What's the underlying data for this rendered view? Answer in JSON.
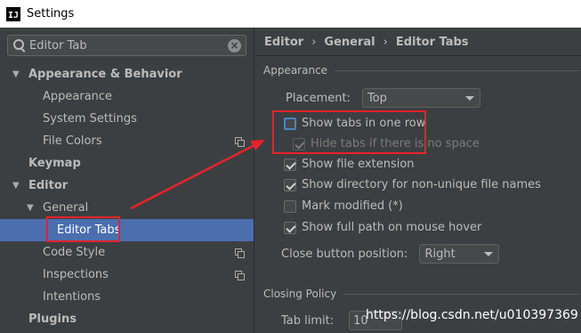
{
  "window": {
    "title": "Settings",
    "app_icon_text": "IJ"
  },
  "search": {
    "value": "Editor Tab",
    "clear_icon": "×"
  },
  "tree": {
    "items": [
      {
        "label": "Appearance & Behavior",
        "bold": true,
        "expanded": true
      },
      {
        "label": "Appearance"
      },
      {
        "label": "System Settings"
      },
      {
        "label": "File Colors"
      },
      {
        "label": "Keymap",
        "bold": true
      },
      {
        "label": "Editor",
        "bold": true,
        "expanded": true
      },
      {
        "label": "General",
        "expanded": true
      },
      {
        "label": "Editor Tabs",
        "selected": true
      },
      {
        "label": "Code Style"
      },
      {
        "label": "Inspections"
      },
      {
        "label": "Intentions"
      },
      {
        "label": "Plugins",
        "bold": true
      }
    ],
    "expanded_arrow": "▼"
  },
  "breadcrumb": {
    "items": [
      "Editor",
      "General",
      "Editor Tabs"
    ],
    "separator": "›"
  },
  "appearance": {
    "heading": "Appearance",
    "placement_label": "Placement:",
    "placement_value": "Top",
    "options": [
      {
        "label": "Show tabs in one row",
        "checked": false
      },
      {
        "label": "Hide tabs if there is no space",
        "checked": true,
        "disabled": true
      },
      {
        "label": "Show file extension",
        "checked": true
      },
      {
        "label": "Show directory for non-unique file names",
        "checked": true
      },
      {
        "label": "Mark modified (*)",
        "checked": false
      },
      {
        "label": "Show full path on mouse hover",
        "checked": true
      }
    ],
    "close_button_label": "Close button position:",
    "close_button_value": "Right"
  },
  "closing_policy": {
    "heading": "Closing Policy",
    "tab_limit_label": "Tab limit:",
    "tab_limit_value": "10"
  },
  "watermark": "https://blog.csdn.net/u010397369",
  "colors": {
    "background": "#3c3f41",
    "selection": "#4b6eaf",
    "annotation": "#e6232a"
  }
}
